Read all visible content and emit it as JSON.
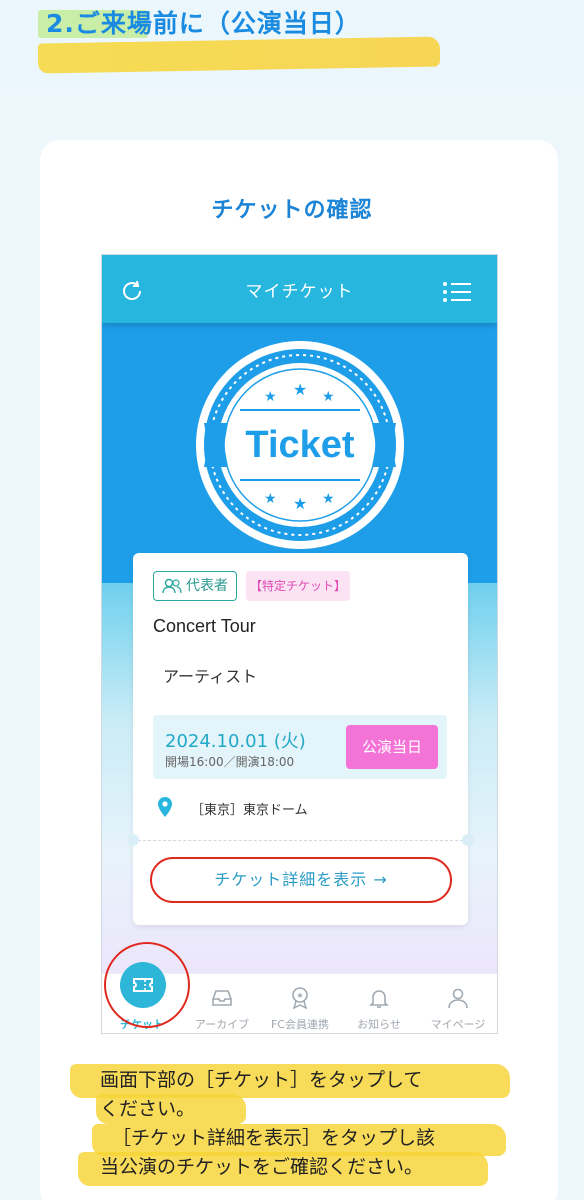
{
  "section": {
    "title": "2.ご来場前に（公演当日）"
  },
  "card": {
    "title": "チケットの確認"
  },
  "phone": {
    "header_title": "マイチケット",
    "refresh_icon": "refresh-icon",
    "menu_icon": "list-menu-icon",
    "hero_logo_text": "Ticket",
    "ticket": {
      "rep_badge": "代表者",
      "special_badge": "【特定チケット】",
      "event_title": "Concert Tour",
      "artist": "アーティスト",
      "date": "2024.10.01 (火)",
      "times": "開場16:00／開演18:00",
      "day_badge": "公演当日",
      "venue": "［東京］東京ドーム"
    },
    "detail_button": "チケット詳細を表示 →",
    "tabs": [
      {
        "label": "チケット",
        "icon": "ticket-icon",
        "active": true
      },
      {
        "label": "アーカイブ",
        "icon": "inbox-icon",
        "active": false
      },
      {
        "label": "FC会員連携",
        "icon": "badge-icon",
        "active": false
      },
      {
        "label": "お知らせ",
        "icon": "bell-icon",
        "active": false
      },
      {
        "label": "マイページ",
        "icon": "person-icon",
        "active": false
      }
    ]
  },
  "instructions": {
    "line1": "画面下部の［チケット］をタップして",
    "line2": "ください。",
    "line3": "［チケット詳細を表示］をタップし該",
    "line4": "当公演のチケットをご確認ください。"
  },
  "colors": {
    "accent_blue": "#1c84d6",
    "header_teal": "#27b6de",
    "hero_blue": "#1e9ee8",
    "pink": "#f374d6",
    "highlight_red": "#e02a20",
    "marker_yellow": "#f7d434"
  }
}
